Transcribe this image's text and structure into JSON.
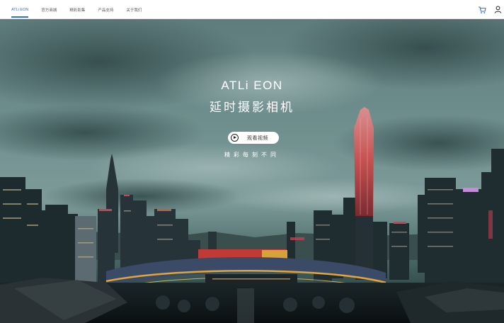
{
  "nav": {
    "items": [
      {
        "label": "ATLi EON",
        "active": true
      },
      {
        "label": "官方商城",
        "active": false
      },
      {
        "label": "精彩影集",
        "active": false
      },
      {
        "label": "产品支持",
        "active": false
      },
      {
        "label": "关于我们",
        "active": false
      }
    ],
    "cart_icon": "shopping-cart-icon",
    "user_icon": "user-icon"
  },
  "hero": {
    "brand": "ATLi EON",
    "subtitle": "延时摄影相机",
    "watch_button": "观看视频",
    "slogan": "精彩每刻不同"
  },
  "colors": {
    "accent": "#2f6fe0",
    "sky": "#6f8f8f",
    "night": "#0d1a1e"
  }
}
